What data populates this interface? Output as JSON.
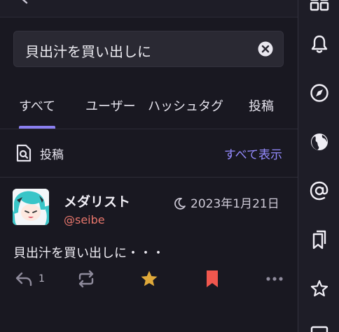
{
  "search": {
    "value": "貝出汁を買い出しに"
  },
  "tabs": [
    {
      "label": "すべて",
      "active": true
    },
    {
      "label": "ユーザー",
      "active": false
    },
    {
      "label": "ハッシュタグ",
      "active": false
    },
    {
      "label": "投稿",
      "active": false
    }
  ],
  "section": {
    "title": "投稿",
    "link": "すべて表示"
  },
  "post": {
    "author": "メダリスト",
    "handle": "@seibe",
    "date": "2023年1月21日",
    "text": "貝出汁を買い出しに・・・",
    "reply_count": "1"
  },
  "icons": {
    "back": "back-arrow-icon",
    "clear": "clear-circle-icon",
    "section": "search-post-icon",
    "moon": "moon-icon",
    "reply": "reply-icon",
    "boost": "boost-icon",
    "favourite": "star-icon",
    "bookmark": "bookmark-icon",
    "more": "more-icon",
    "rail": [
      "grid-icon",
      "bell-icon",
      "compass-icon",
      "globe-icon",
      "at-icon",
      "bookmarks-icon",
      "star-icon",
      "list-icon"
    ]
  },
  "colors": {
    "accent": "#8a7ff0",
    "link": "#958bff",
    "handle": "#e8766c",
    "star": "#e0a93a",
    "bookmark": "#f0574e",
    "background": "#191821"
  }
}
